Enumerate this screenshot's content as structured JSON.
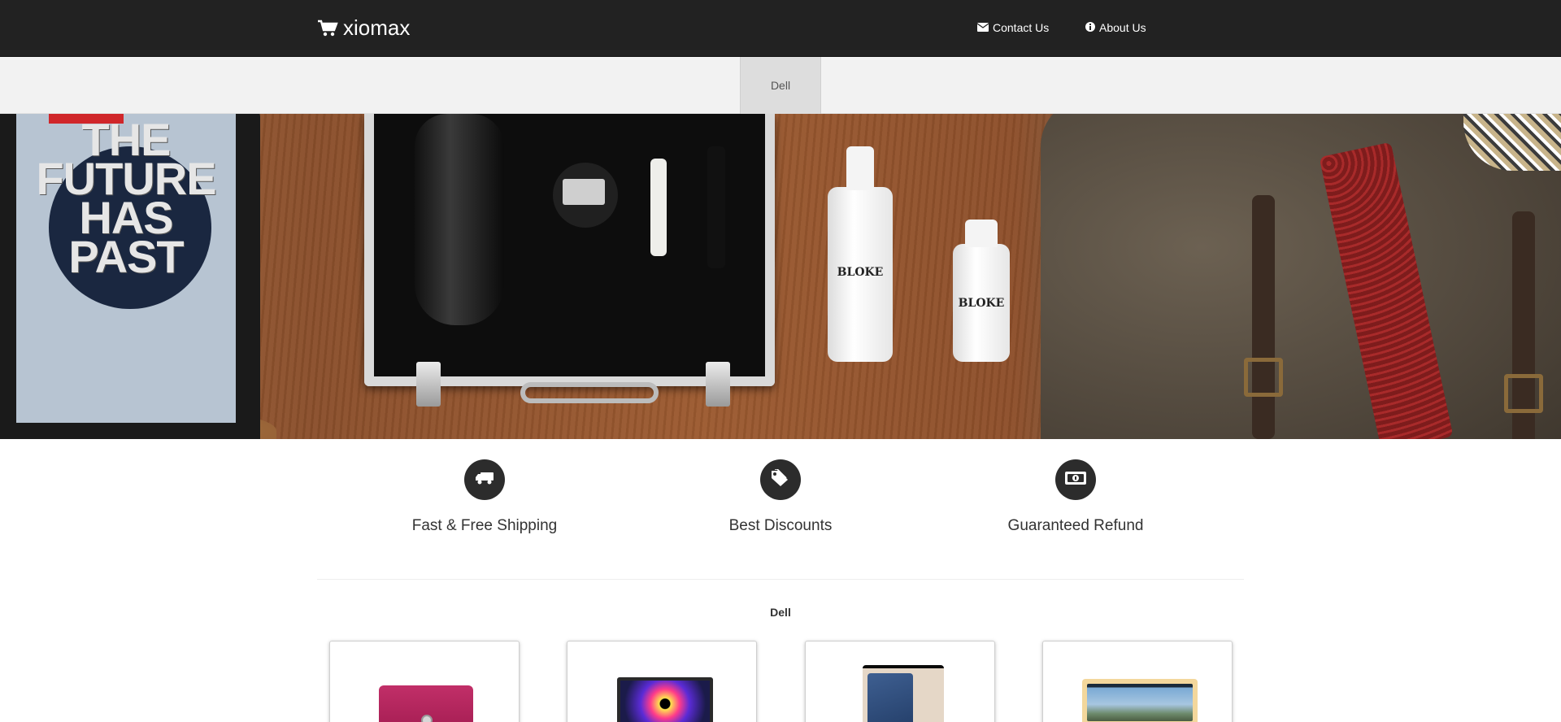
{
  "header": {
    "brand": "xiomax",
    "brand_icon": "shopping-cart-icon",
    "links": [
      {
        "label": "Contact Us",
        "icon": "envelope-icon"
      },
      {
        "label": "About Us",
        "icon": "info-circle-icon"
      }
    ]
  },
  "categories": {
    "items": [
      "Dell"
    ],
    "active": "Dell"
  },
  "hero": {
    "magazine_headline": "THE FUTURE HAS PAST",
    "bottle_label_1": "BLOKE",
    "bottle_label_2": "BLOKE"
  },
  "features": [
    {
      "title": "Fast & Free Shipping",
      "icon": "truck-icon"
    },
    {
      "title": "Best Discounts",
      "icon": "tags-icon"
    },
    {
      "title": "Guaranteed Refund",
      "icon": "money-bill-icon"
    }
  ],
  "section": {
    "title": "Dell"
  },
  "products": [
    {
      "image": "pink-laptop"
    },
    {
      "image": "laptop-colorful-screen"
    },
    {
      "image": "blue-tablet"
    },
    {
      "image": "laptop-windows-screen"
    }
  ],
  "colors": {
    "navbar": "#222222",
    "category_bar": "#f2f2f2",
    "active_tab": "#dddddd",
    "feature_icon_bg": "#2c2c2c"
  }
}
